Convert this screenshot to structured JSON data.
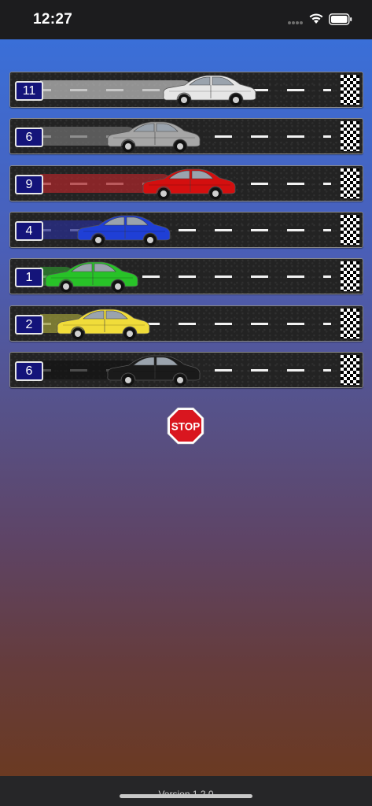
{
  "status_bar": {
    "time": "12:27"
  },
  "lanes": [
    {
      "number": "11",
      "car_color": "#e6e6e6",
      "trail_color": "#b8b8b8",
      "progress": 0.73
    },
    {
      "number": "6",
      "car_color": "#a6a6a6",
      "trail_color": "#6e6e6e",
      "progress": 0.54
    },
    {
      "number": "9",
      "car_color": "#d40f0f",
      "trail_color": "#a8272b",
      "progress": 0.66
    },
    {
      "number": "4",
      "car_color": "#1f3fd6",
      "trail_color": "#2a2f8e",
      "progress": 0.44
    },
    {
      "number": "1",
      "car_color": "#28c228",
      "trail_color": "#2f8a2f",
      "progress": 0.33
    },
    {
      "number": "2",
      "car_color": "#f0dc3a",
      "trail_color": "#98973a",
      "progress": 0.37
    },
    {
      "number": "6",
      "car_color": "#1a1a1a",
      "trail_color": "#141414",
      "progress": 0.54
    }
  ],
  "stop_button": {
    "label": "STOP",
    "color": "#d9161f"
  },
  "footer": {
    "version": "Version 1.2.0"
  }
}
